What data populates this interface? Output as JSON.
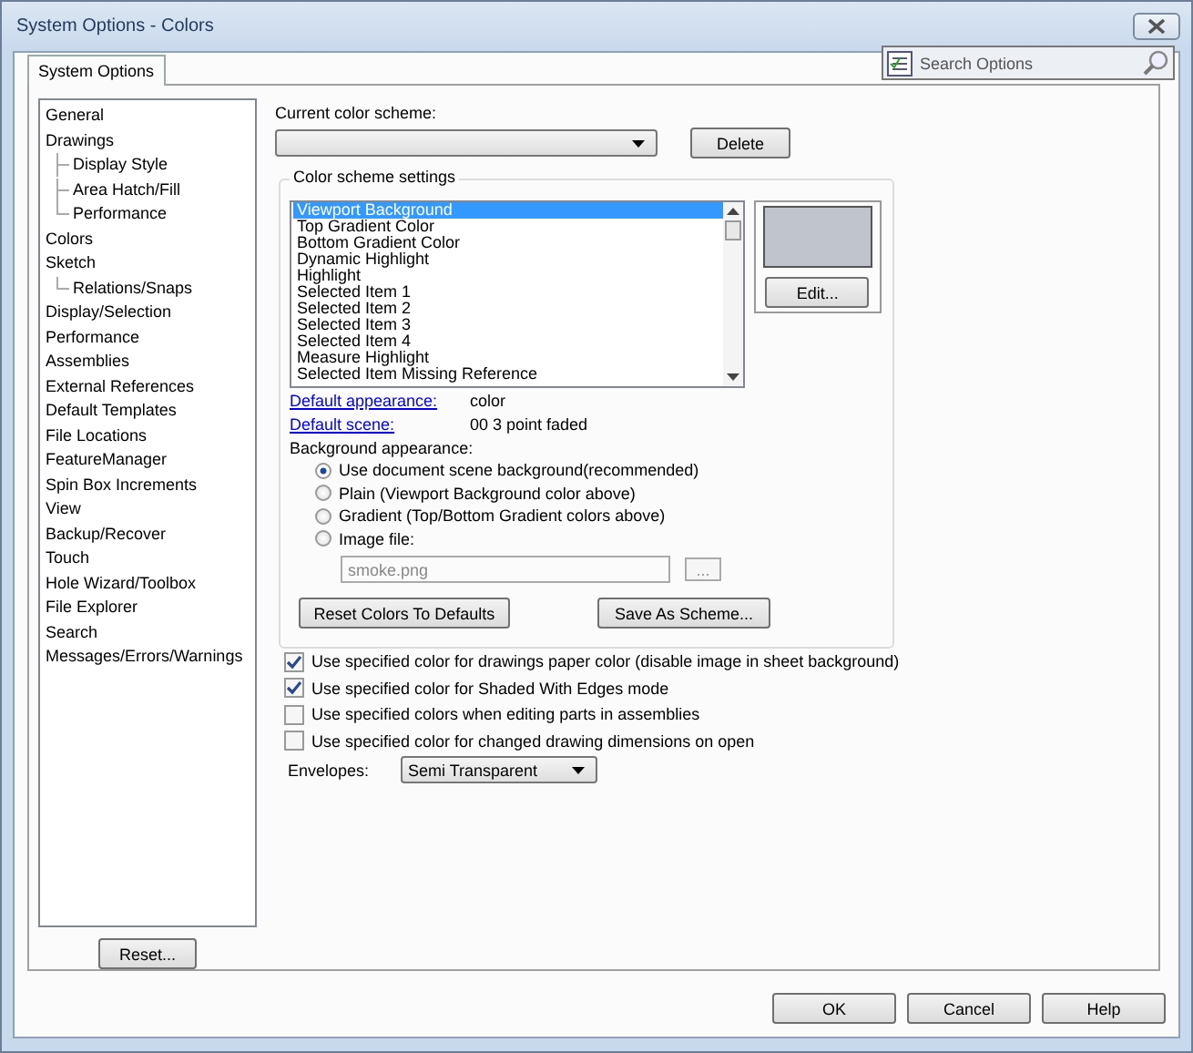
{
  "window": {
    "title": "System Options - Colors"
  },
  "tabs": [
    {
      "label": "System Options",
      "selected": true
    }
  ],
  "search": {
    "placeholder": "Search Options"
  },
  "tree": [
    {
      "label": "General"
    },
    {
      "label": "Drawings",
      "children": [
        {
          "label": "Display Style"
        },
        {
          "label": "Area Hatch/Fill"
        },
        {
          "label": "Performance"
        }
      ]
    },
    {
      "label": "Colors"
    },
    {
      "label": "Sketch",
      "children": [
        {
          "label": "Relations/Snaps"
        }
      ]
    },
    {
      "label": "Display/Selection"
    },
    {
      "label": "Performance"
    },
    {
      "label": "Assemblies"
    },
    {
      "label": "External References"
    },
    {
      "label": "Default Templates"
    },
    {
      "label": "File Locations"
    },
    {
      "label": "FeatureManager"
    },
    {
      "label": "Spin Box Increments"
    },
    {
      "label": "View"
    },
    {
      "label": "Backup/Recover"
    },
    {
      "label": "Touch"
    },
    {
      "label": "Hole Wizard/Toolbox"
    },
    {
      "label": "File Explorer"
    },
    {
      "label": "Search"
    },
    {
      "label": "Messages/Errors/Warnings"
    }
  ],
  "reset_button": "Reset...",
  "scheme": {
    "label": "Current color scheme:",
    "delete_button": "Delete"
  },
  "scheme_settings": {
    "title": "Color scheme settings",
    "items": [
      {
        "label": "Viewport Background",
        "selected": true
      },
      {
        "label": "Top Gradient Color",
        "selected": false
      },
      {
        "label": "Bottom Gradient Color",
        "selected": false
      },
      {
        "label": "Dynamic Highlight",
        "selected": false
      },
      {
        "label": "Highlight",
        "selected": false
      },
      {
        "label": "Selected Item 1",
        "selected": false
      },
      {
        "label": "Selected Item 2",
        "selected": false
      },
      {
        "label": "Selected Item 3",
        "selected": false
      },
      {
        "label": "Selected Item 4",
        "selected": false
      },
      {
        "label": "Measure Highlight",
        "selected": false
      },
      {
        "label": "Selected Item Missing Reference",
        "selected": false
      }
    ],
    "swatch": {
      "color": "#c0c4cc"
    },
    "edit_button": "Edit...",
    "default_appearance": {
      "label": "Default appearance:",
      "value": "color"
    },
    "default_scene": {
      "label": "Default scene:",
      "value": "00 3 point faded"
    },
    "background_label": "Background appearance:",
    "background_options": [
      {
        "label": "Use document scene background(recommended)",
        "selected": true
      },
      {
        "label": "Plain (Viewport Background color above)",
        "selected": false
      },
      {
        "label": "Gradient (Top/Bottom Gradient colors above)",
        "selected": false
      },
      {
        "label": "Image file:",
        "selected": false
      }
    ],
    "image_file": {
      "value": "smoke.png",
      "disabled": true,
      "browse_button": "..."
    },
    "reset_colors_button": "Reset Colors To Defaults",
    "save_scheme_button": "Save As Scheme..."
  },
  "checkboxes": [
    {
      "label": "Use specified color for drawings paper color (disable image in sheet background)",
      "checked": true
    },
    {
      "label": "Use specified color for Shaded With Edges mode",
      "checked": true
    },
    {
      "label": "Use specified colors when editing parts in assemblies",
      "checked": false
    },
    {
      "label": "Use specified color for changed drawing dimensions on open",
      "checked": false
    }
  ],
  "envelopes": {
    "label": "Envelopes:",
    "value": "Semi Transparent"
  },
  "buttons": [
    "OK",
    "Cancel",
    "Help"
  ]
}
